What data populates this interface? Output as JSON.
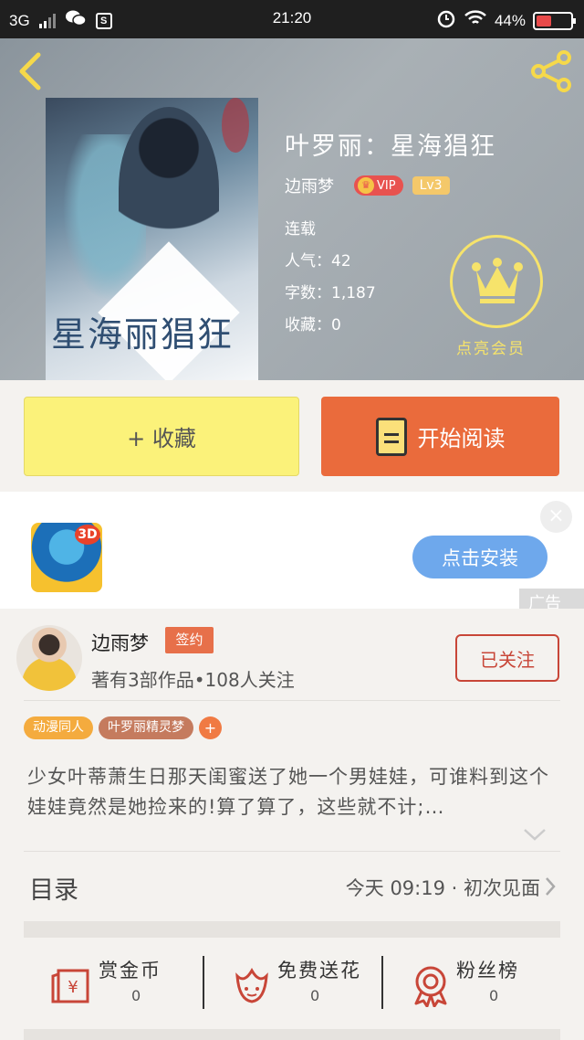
{
  "status_bar": {
    "network": "3G",
    "time": "21:20",
    "battery": "44%",
    "battery_level": 0.44
  },
  "book": {
    "title": "叶罗丽：星海猖狂",
    "author": "边雨梦",
    "vip_label": "VIP",
    "level": "Lv3",
    "status": "连载",
    "popularity": "人气：42",
    "word_count": "字数：1,187",
    "favorites": "收藏：0",
    "cover_title_art": "星海丽猖狂"
  },
  "member": {
    "label": "点亮会员"
  },
  "actions": {
    "collect_label": "+ 收藏",
    "read_label": "开始阅读"
  },
  "ad": {
    "install_label": "点击安装",
    "ad_label": "广告",
    "close_icon": "×",
    "icon_tag": "3D"
  },
  "author_info": {
    "name": "边雨梦",
    "sign_badge": "签约",
    "stats": "著有3部作品•108人关注",
    "follow_label": "已关注"
  },
  "tags": [
    "动漫同人",
    "叶罗丽精灵梦",
    "+"
  ],
  "synopsis": "少女叶蒂萧生日那天闺蜜送了她一个男娃娃，可谁料到这个娃娃竟然是她捡来的!算了算了，这些就不计;…",
  "toc": {
    "title": "目录",
    "latest": "今天 09:19 · 初次见面"
  },
  "rewards": [
    {
      "label": "赏金币",
      "count": "0",
      "icon": "red-envelope-icon"
    },
    {
      "label": "免费送花",
      "count": "0",
      "icon": "flower-icon"
    },
    {
      "label": "粉丝榜",
      "count": "0",
      "icon": "medal-icon"
    }
  ],
  "colors": {
    "collect_bg": "#fbf27a",
    "read_bg": "#ea6b3c",
    "accent_red": "#c84638",
    "member_gold": "#f6e36b",
    "install_blue": "#6ea8ec"
  }
}
